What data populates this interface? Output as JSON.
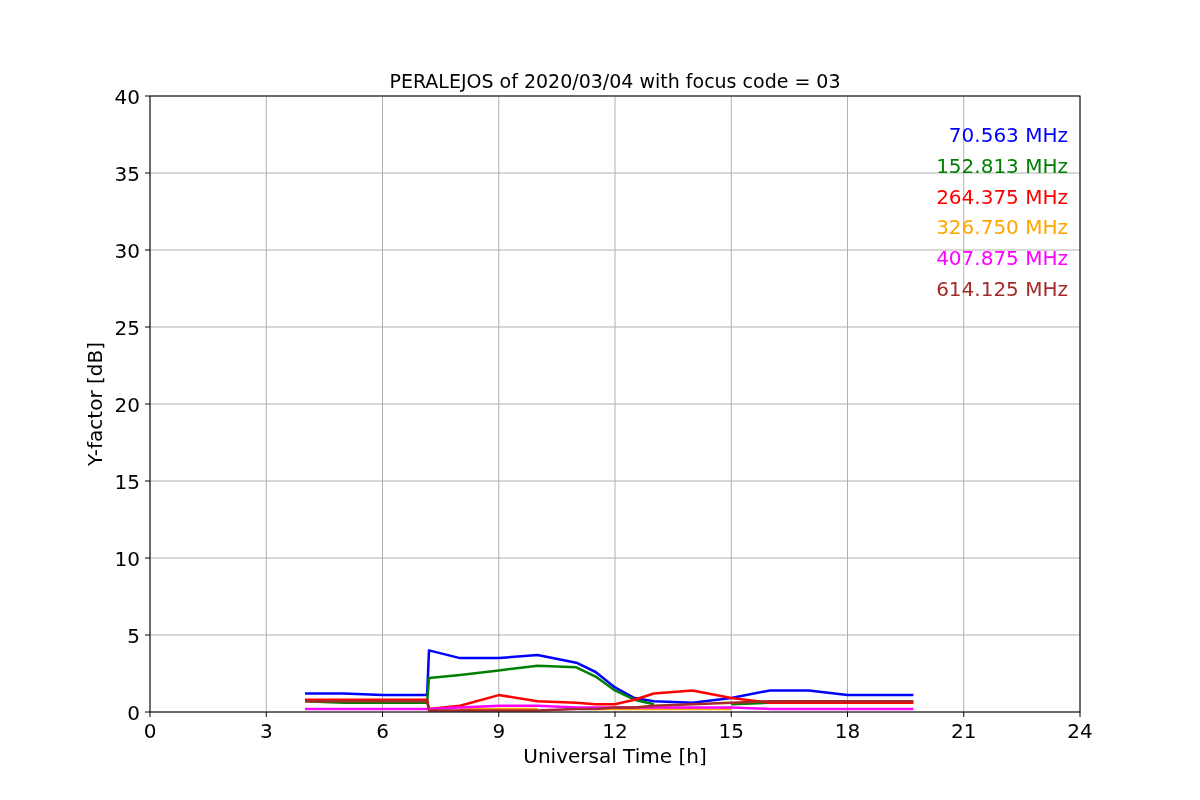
{
  "figure": {
    "chart_data": {
      "type": "line",
      "title": "PERALEJOS of 2020/03/04 with focus code = 03",
      "xlabel": "Universal Time [h]",
      "ylabel": "Y-factor [dB]",
      "x": [
        4,
        5,
        6,
        7,
        7.15,
        7.2,
        8,
        9,
        10,
        11,
        11.5,
        12,
        12.5,
        13,
        14,
        15,
        16,
        17,
        18,
        19,
        19.7
      ],
      "series": [
        {
          "name": "70.563 MHz",
          "color": "#0000ff",
          "values": [
            1.2,
            1.2,
            1.1,
            1.1,
            1.1,
            4.0,
            3.5,
            3.5,
            3.7,
            3.2,
            2.6,
            1.6,
            0.9,
            0.7,
            0.6,
            0.9,
            1.4,
            1.4,
            1.1,
            1.1,
            1.1
          ]
        },
        {
          "name": "152.813 MHz",
          "color": "#008000",
          "values": [
            0.7,
            0.6,
            0.6,
            0.6,
            0.6,
            2.2,
            2.4,
            2.7,
            3.0,
            2.9,
            2.3,
            1.4,
            0.8,
            0.5,
            null,
            0.5,
            0.6,
            null,
            null,
            null,
            null
          ]
        },
        {
          "name": "264.375 MHz",
          "color": "#ff0000",
          "values": [
            0.8,
            0.8,
            0.8,
            0.8,
            0.8,
            0.2,
            0.4,
            1.1,
            0.7,
            0.6,
            0.5,
            0.5,
            0.8,
            1.2,
            1.4,
            0.9,
            0.6,
            0.6,
            0.6,
            0.6,
            0.6
          ]
        },
        {
          "name": "326.750 MHz",
          "color": "#ffa500",
          "values": [
            null,
            null,
            null,
            null,
            null,
            null,
            0.2,
            0.2,
            0.2,
            null,
            0.2,
            0.2,
            0.2,
            0.2,
            0.2,
            0.2,
            null,
            null,
            null,
            null,
            null
          ]
        },
        {
          "name": "407.875 MHz",
          "color": "#ff00ff",
          "values": [
            0.2,
            0.2,
            0.2,
            0.2,
            0.2,
            0.2,
            0.3,
            0.4,
            0.4,
            0.3,
            0.3,
            0.3,
            0.3,
            0.3,
            0.3,
            0.3,
            0.2,
            0.2,
            0.2,
            0.2,
            0.2
          ]
        },
        {
          "name": "614.125 MHz",
          "color": "#a52a2a",
          "values": [
            0.7,
            0.7,
            0.7,
            0.7,
            0.7,
            0.1,
            0.1,
            0.1,
            0.1,
            0.2,
            0.2,
            0.3,
            0.3,
            0.4,
            0.5,
            0.6,
            0.7,
            0.7,
            0.7,
            0.7,
            0.7
          ]
        }
      ],
      "grid": true,
      "xlim": [
        0,
        24
      ],
      "ylim": [
        0,
        40
      ],
      "xticks": [
        0,
        3,
        6,
        9,
        12,
        15,
        18,
        21,
        24
      ],
      "yticks": [
        0,
        5,
        10,
        15,
        20,
        25,
        30,
        35,
        40
      ]
    }
  }
}
